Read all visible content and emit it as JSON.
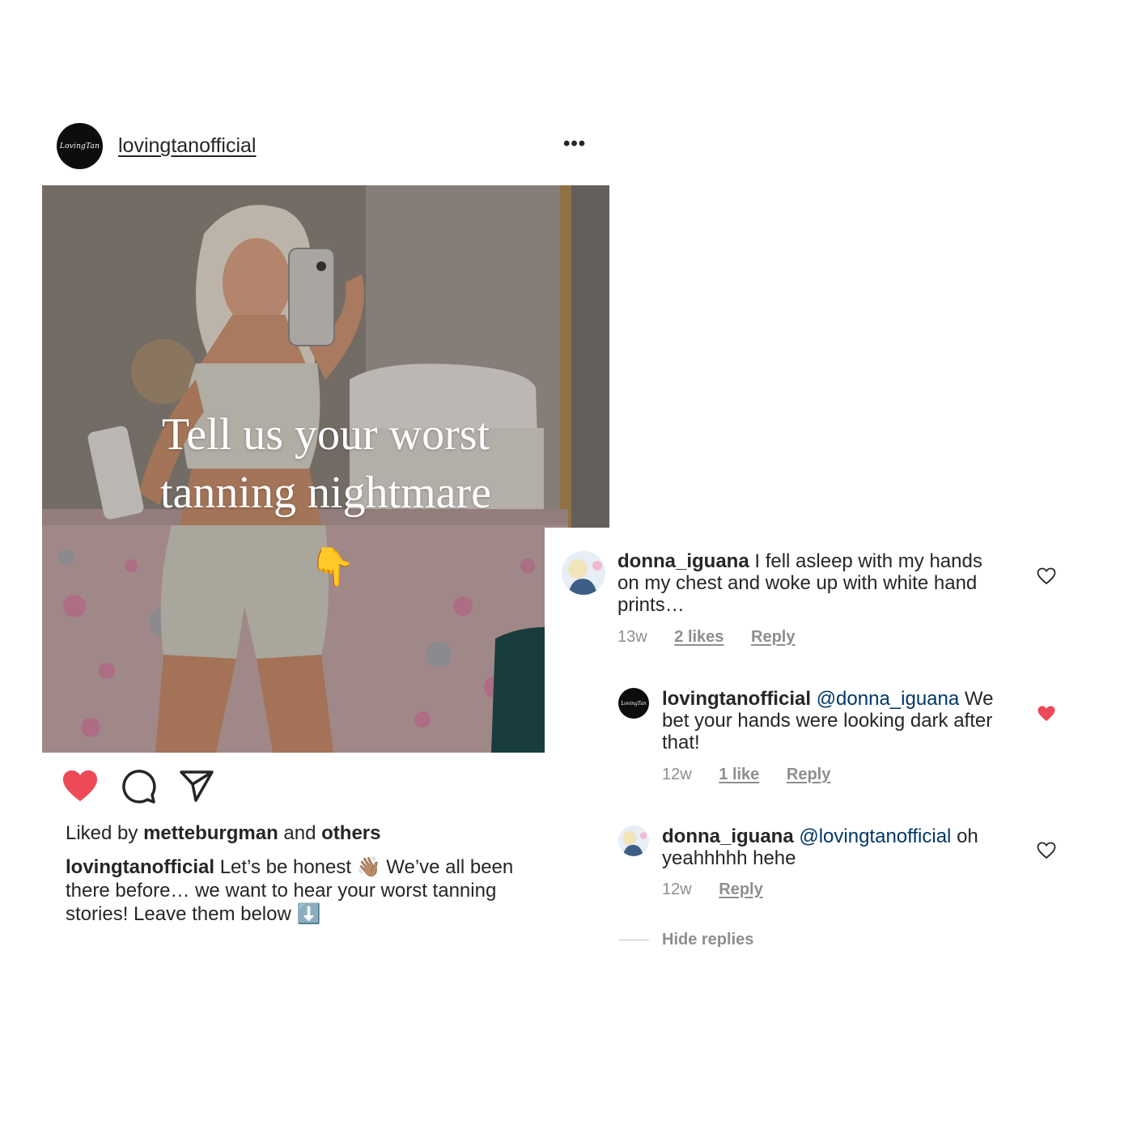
{
  "post": {
    "username": "lovingtanofficial",
    "avatar_logo_text": "LovingTan",
    "more_icon": "more-horizontal-icon",
    "image": {
      "overlay_line1": "Tell us your worst",
      "overlay_line2": "tanning nightmare",
      "emoji": "👇"
    },
    "actions": {
      "like_icon": "heart-filled-icon",
      "comment_icon": "comment-icon",
      "share_icon": "paper-plane-icon",
      "like_color": "#ed4956"
    },
    "likes": {
      "prefix": "Liked by",
      "user": "metteburgman",
      "conjunction": "and",
      "others": "others"
    },
    "caption": {
      "username": "lovingtanofficial",
      "text": "Let’s be honest 👋🏽 We’ve all been there before… we want to hear your worst tanning stories! Leave them below ⬇️"
    }
  },
  "comments": [
    {
      "username": "donna_iguana",
      "mention": "",
      "text": "I fell asleep with my hands on my chest and woke up with white hand prints…",
      "time": "13w",
      "likes": "2 likes",
      "reply": "Reply",
      "liked": false
    },
    {
      "username": "lovingtanofficial",
      "mention": "@donna_iguana",
      "text": "We bet your hands were looking dark after that!",
      "time": "12w",
      "likes": "1 like",
      "reply": "Reply",
      "liked": true
    },
    {
      "username": "donna_iguana",
      "mention": "@lovingtanofficial",
      "text": "oh yeahhhhh hehe",
      "time": "12w",
      "likes": "",
      "reply": "Reply",
      "liked": false
    }
  ],
  "hide_replies": "Hide replies",
  "colors": {
    "text": "#262626",
    "muted": "#8e8e8e",
    "mention": "#00376b",
    "heart_red": "#ed4956"
  }
}
